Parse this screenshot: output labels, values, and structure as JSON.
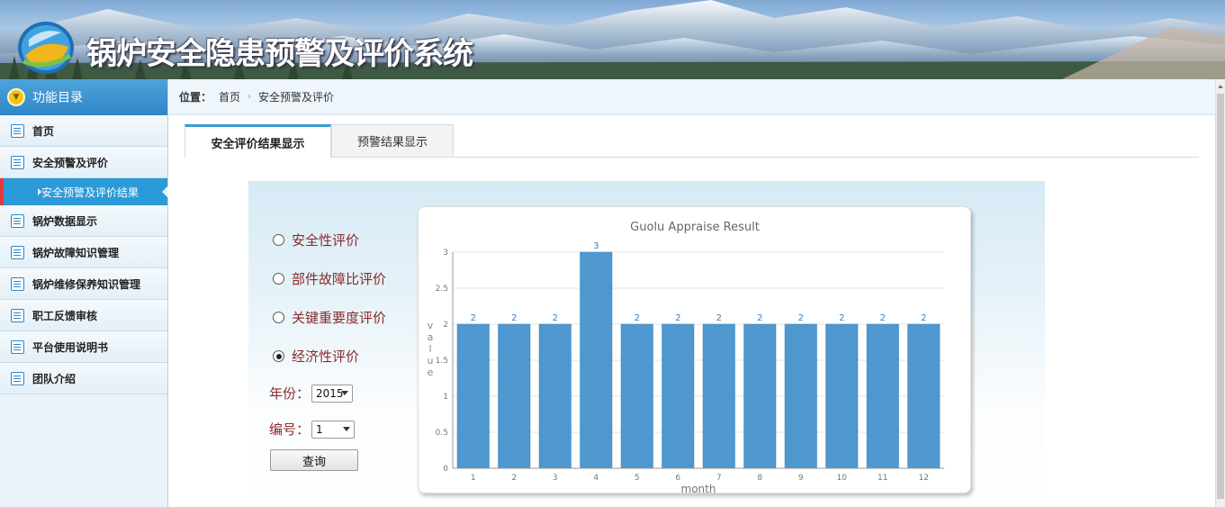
{
  "header": {
    "site_title": "锅炉安全隐患预警及评价系统"
  },
  "sidebar": {
    "title": "功能目录",
    "items": [
      {
        "label": "首页"
      },
      {
        "label": "安全预警及评价"
      },
      {
        "label": "安全预警及评价结果",
        "sub": true,
        "active": true
      },
      {
        "label": "锅炉数据显示"
      },
      {
        "label": "锅炉故障知识管理"
      },
      {
        "label": "锅炉维修保养知识管理"
      },
      {
        "label": "职工反馈审核"
      },
      {
        "label": "平台使用说明书"
      },
      {
        "label": "团队介绍"
      }
    ]
  },
  "breadcrumb": {
    "prefix": "位置：",
    "home": "首页",
    "current": "安全预警及评价"
  },
  "tabs": [
    {
      "label": "安全评价结果显示",
      "active": true
    },
    {
      "label": "预警结果显示",
      "active": false
    }
  ],
  "form": {
    "options": [
      {
        "label": "安全性评价",
        "checked": false
      },
      {
        "label": "部件故障比评价",
        "checked": false
      },
      {
        "label": "关键重要度评价",
        "checked": false
      },
      {
        "label": "经济性评价",
        "checked": true
      }
    ],
    "year_label": "年份：",
    "year_value": "2015",
    "number_label": "编号：",
    "number_value": "1",
    "query_button": "查询"
  },
  "chart_data": {
    "type": "bar",
    "title": "Guolu Appraise Result",
    "xlabel": "month",
    "ylabel": "value",
    "categories": [
      "1",
      "2",
      "3",
      "4",
      "5",
      "6",
      "7",
      "8",
      "9",
      "10",
      "11",
      "12"
    ],
    "values": [
      2,
      2,
      2,
      3,
      2,
      2,
      2,
      2,
      2,
      2,
      2,
      2
    ],
    "ylim": [
      0,
      3
    ],
    "yticks": [
      "0",
      "0.5",
      "1",
      "1.5",
      "2",
      "2.5",
      "3"
    ],
    "bar_color": "#4f97cf",
    "grid": true,
    "data_labels": true
  }
}
